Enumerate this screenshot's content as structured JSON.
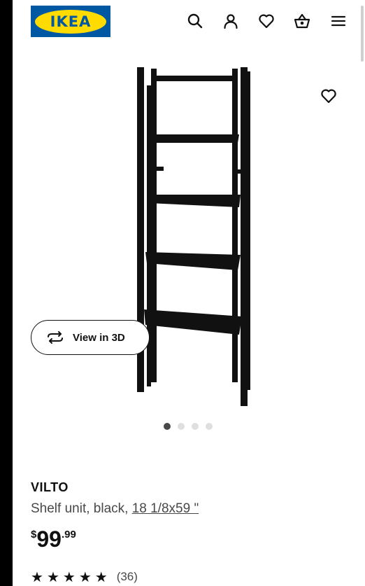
{
  "header": {
    "logo_text": "IKEA",
    "icons": [
      "search-icon",
      "account-icon",
      "favourites-icon",
      "basket-icon",
      "menu-icon"
    ]
  },
  "gallery": {
    "view_in_3d_label": "View in 3D",
    "image_count": 4,
    "active_index": 0
  },
  "product": {
    "name": "VILTO",
    "description": "Shelf unit, black, ",
    "size": "18 1/8x59 \"",
    "price": {
      "currency": "$",
      "integer": "99",
      "decimal": ".99"
    },
    "rating_stars": 5,
    "review_count": "(36)"
  },
  "colors": {
    "brand_blue": "#0058a3",
    "brand_yellow": "#ffdb00",
    "text": "#111111",
    "muted_text": "#484848"
  }
}
